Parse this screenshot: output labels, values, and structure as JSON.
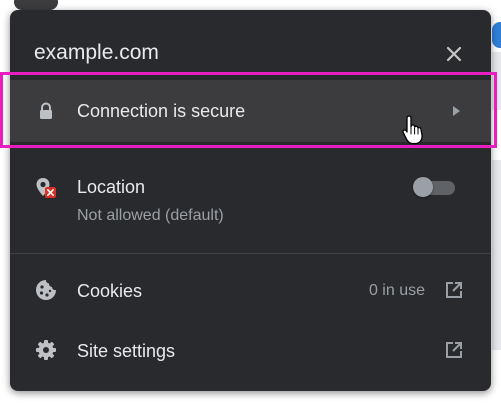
{
  "header": {
    "site": "example.com",
    "close_icon": "close-icon"
  },
  "connection": {
    "label": "Connection is secure",
    "icon": "lock-icon",
    "chevron_icon": "chevron-right-icon"
  },
  "location": {
    "label": "Location",
    "status": "Not allowed (default)",
    "icon": "location-blocked-icon",
    "toggle_on": false
  },
  "cookies": {
    "label": "Cookies",
    "count": "0 in use",
    "icon": "cookie-icon",
    "link_icon": "open-external-icon"
  },
  "site_settings": {
    "label": "Site settings",
    "icon": "gear-icon",
    "link_icon": "open-external-icon"
  },
  "colors": {
    "panel_bg": "#292a2d",
    "row_hover": "#3c3c3f",
    "text_primary": "#e8eaed",
    "text_secondary": "#9aa0a6",
    "highlight": "#e91ec0",
    "error_badge": "#d93025"
  }
}
